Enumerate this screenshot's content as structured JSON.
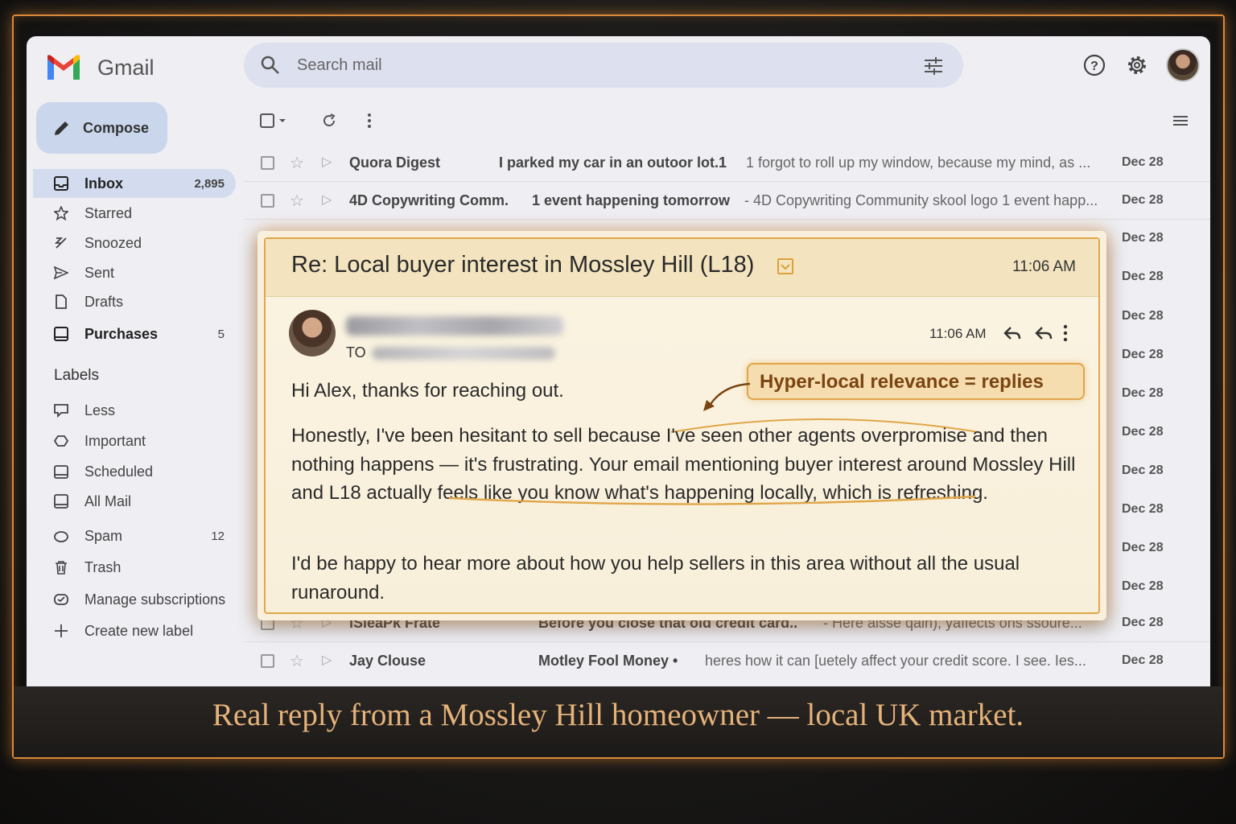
{
  "app": {
    "name": "Gmail"
  },
  "search": {
    "placeholder": "Search mail"
  },
  "sidebar": {
    "compose_label": "Compose",
    "items": [
      {
        "label": "Inbox",
        "count": "2,895"
      },
      {
        "label": "Starred",
        "count": ""
      },
      {
        "label": "Snoozed",
        "count": ""
      },
      {
        "label": "Sent",
        "count": ""
      },
      {
        "label": "Drafts",
        "count": ""
      },
      {
        "label": "Purchases",
        "count": "5"
      }
    ],
    "labels_heading": "Labels",
    "labels": [
      {
        "label": "Less",
        "count": ""
      },
      {
        "label": "Important",
        "count": ""
      },
      {
        "label": "Scheduled",
        "count": ""
      },
      {
        "label": "All Mail",
        "count": ""
      },
      {
        "label": "Spam",
        "count": "12"
      },
      {
        "label": "Trash",
        "count": ""
      },
      {
        "label": "Manage subscriptions",
        "count": ""
      },
      {
        "label": "Create new label",
        "count": ""
      }
    ]
  },
  "list": {
    "rows": [
      {
        "sender": "Quora Digest",
        "subject": "I parked my car in an outoor lot.1",
        "snippet": "1 forgot to roll up my window, because my mind, as ...",
        "date": "Dec 28"
      },
      {
        "sender": "4D Copywriting Comm.",
        "subject": "1 event happening tomorrow",
        "snippet": "- 4D Copywriting Community skool logo 1 event happ...",
        "date": "Dec 28"
      },
      {
        "sender": "iSleaPk Frate",
        "subject": "Before you close that old credit card..",
        "snippet": "- Here aisse qain), yaffects ons ssoure...",
        "date": "Dec 28"
      },
      {
        "sender": "Jay Clouse",
        "subject": "Motley Fool Money •",
        "snippet": "heres how it can [uetely affect your credit score. I see. Ies...",
        "date": "Dec 28"
      }
    ],
    "hidden_dates": [
      "Dec 28",
      "Dec 28",
      "Dec 28",
      "Dec 28",
      "Dec 28",
      "Dec 28",
      "Dec 28",
      "Dec 28",
      "Dec 28",
      "Dec 28"
    ]
  },
  "email": {
    "subject": "Re: Local buyer interest in Mossley Hill (L18)",
    "time_header": "11:06 AM",
    "time_message": "11:06 AM",
    "to_label": "TO",
    "callout": "Hyper-local relevance = replies",
    "greeting": "Hi Alex, thanks for reaching out.",
    "paragraph1": "Honestly, I've been hesitant to sell because I've seen other agents overpromise and then nothing happens — it's frustrating. Your email mentioning buyer interest around Mossley Hill and L18 actually feels like you know what's happening locally, which is refreshing.",
    "paragraph2": "I'd be happy to hear more about how you help sellers in this area without all the usual runaround."
  },
  "caption": "Real reply from a Mossley Hill homeowner — local UK market.",
  "colors": {
    "accent_orange": "#e0a64a",
    "caption": "#e5b27a",
    "inbox_active": "#d3dcef"
  }
}
